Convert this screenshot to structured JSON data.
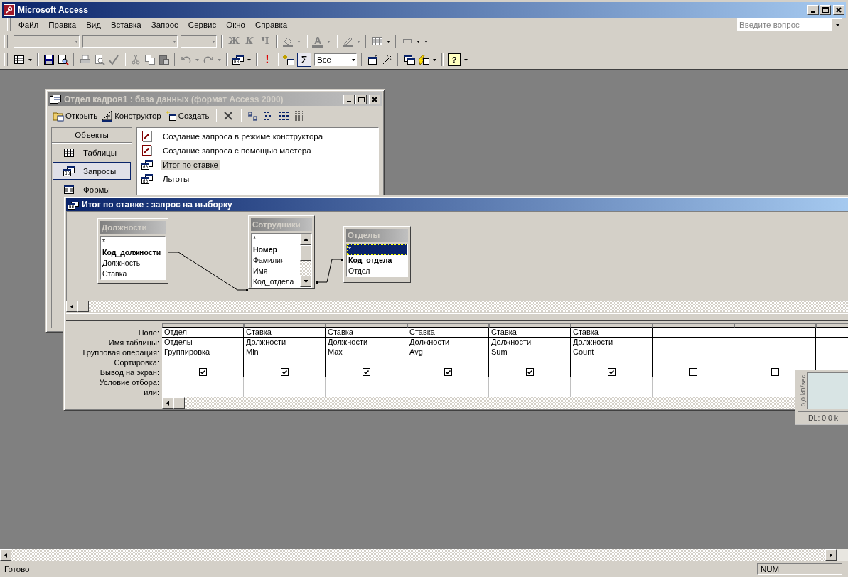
{
  "window": {
    "title": "Microsoft Access"
  },
  "menu": [
    "Файл",
    "Правка",
    "Вид",
    "Вставка",
    "Запрос",
    "Сервис",
    "Окно",
    "Справка"
  ],
  "ask_box": {
    "placeholder": "Введите вопрос"
  },
  "formatting_toolbar": {
    "bold": "Ж",
    "italic": "К",
    "underline": "Ч",
    "font_color": "A"
  },
  "query_toolbar": {
    "run": "!",
    "totals": {
      "label": "Σ",
      "selected": true
    },
    "top_values": "Все",
    "help": "?"
  },
  "db_window": {
    "title": "Отдел кадров1 : база данных (формат Access 2000)",
    "actions": [
      {
        "label": "Открыть",
        "kind": "open"
      },
      {
        "label": "Конструктор",
        "kind": "design"
      },
      {
        "label": "Создать",
        "kind": "new"
      }
    ],
    "objects_header": "Объекты",
    "objects": [
      {
        "label": "Таблицы",
        "kind": "table",
        "selected": false
      },
      {
        "label": "Запросы",
        "kind": "query",
        "selected": true
      },
      {
        "label": "Формы",
        "kind": "form",
        "selected": false
      }
    ],
    "items": [
      {
        "label": "Создание запроса в режиме конструктора",
        "kind": "wizard",
        "selected": false
      },
      {
        "label": "Создание запроса с помощью мастера",
        "kind": "wizard",
        "selected": false
      },
      {
        "label": "Итог по ставке",
        "kind": "query",
        "selected": true
      },
      {
        "label": "Льготы",
        "kind": "query",
        "selected": false
      }
    ]
  },
  "query_window": {
    "title": "Итог по ставке : запрос на выборку",
    "tables": [
      {
        "name": "Должности",
        "scrollbar": false,
        "fields": [
          {
            "label": "*",
            "key": false,
            "selected": false
          },
          {
            "label": "Код_должности",
            "key": true,
            "selected": false
          },
          {
            "label": "Должность",
            "key": false,
            "selected": false
          },
          {
            "label": "Ставка",
            "key": false,
            "selected": false
          }
        ]
      },
      {
        "name": "Сотрудники",
        "scrollbar": true,
        "fields": [
          {
            "label": "*",
            "key": false,
            "selected": false
          },
          {
            "label": "Номер",
            "key": true,
            "selected": false
          },
          {
            "label": "Фамилия",
            "key": false,
            "selected": false
          },
          {
            "label": "Имя",
            "key": false,
            "selected": false
          },
          {
            "label": "Код_отдела",
            "key": false,
            "selected": false
          }
        ]
      },
      {
        "name": "Отделы",
        "scrollbar": false,
        "fields": [
          {
            "label": "*",
            "key": false,
            "selected": true
          },
          {
            "label": "Код_отдела",
            "key": true,
            "selected": false
          },
          {
            "label": "Отдел",
            "key": false,
            "selected": false
          }
        ]
      }
    ],
    "row_labels": [
      "Поле:",
      "Имя таблицы:",
      "Групповая операция:",
      "Сортировка:",
      "Вывод на экран:",
      "Условие отбора:",
      "или:"
    ],
    "columns": [
      {
        "field": "Отдел",
        "table": "Отделы",
        "total": "Группировка",
        "show": true
      },
      {
        "field": "Ставка",
        "table": "Должности",
        "total": "Min",
        "show": true
      },
      {
        "field": "Ставка",
        "table": "Должности",
        "total": "Max",
        "show": true
      },
      {
        "field": "Ставка",
        "table": "Должности",
        "total": "Avg",
        "show": true
      },
      {
        "field": "Ставка",
        "table": "Должности",
        "total": "Sum",
        "show": true
      },
      {
        "field": "Ставка",
        "table": "Должности",
        "total": "Count",
        "show": true
      },
      {
        "show": false
      },
      {
        "show": false
      }
    ]
  },
  "speed_widget": {
    "rate": "0,0 kB/sec",
    "download": "DL: 0,0 k"
  },
  "status_bar": {
    "text": "Готово",
    "indicator": "NUM"
  }
}
